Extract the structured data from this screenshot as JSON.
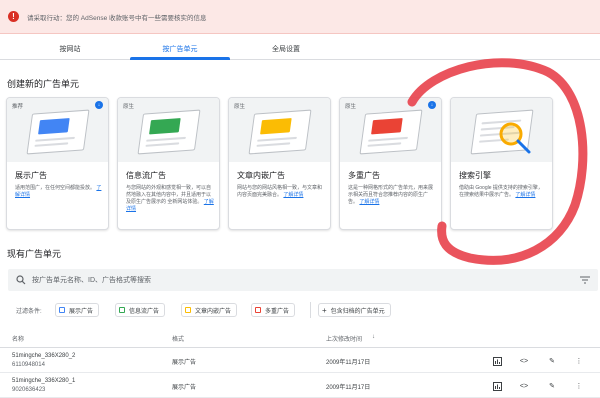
{
  "alert": {
    "text": "请采取行动：您的 AdSense 收款账号中有一些需要核实的信息"
  },
  "tabs": [
    {
      "label": "按网站"
    },
    {
      "label": "按广告单元"
    },
    {
      "label": "全局设置"
    }
  ],
  "create_section": {
    "title": "创建新的广告单元"
  },
  "cards": [
    {
      "tag": "推荐",
      "title": "展示广告",
      "desc": "适用范围广，在任何空间都能投放。",
      "link": "了解详情",
      "accent": "#4285f4"
    },
    {
      "tag": "原生",
      "title": "信息流广告",
      "desc": "与您网站的外观和感觉相一致，可以自然地融入在其他内容中，并且适用于以及原生广告展示的 全新网站体验。",
      "link": "了解详情",
      "accent": "#34a853"
    },
    {
      "tag": "原生",
      "title": "文章内嵌广告",
      "desc": "网站与您的网站风格相一致，与文章和内容页面完美融合。",
      "link": "了解详情",
      "accent": "#fbbc04"
    },
    {
      "tag": "原生",
      "title": "多重广告",
      "desc": "这是一种网格形式的广告单元，用来展示相关而且符合您推荐内容的原生广告。",
      "link": "了解详情",
      "accent": "#ea4335"
    },
    {
      "tag": "",
      "title": "搜索引擎",
      "desc": "借助由 Google 提供支持的搜索引擎，在搜索结果中展示广告。",
      "link": "了解详情",
      "accent": "#fbbc04"
    }
  ],
  "existing_section": {
    "title": "现有广告单元"
  },
  "search": {
    "placeholder": "按广告单元名称、ID、广告格式等搜索"
  },
  "filters": {
    "label": "过滤条件:",
    "chips": [
      {
        "label": "展示广告",
        "color": "#4285f4"
      },
      {
        "label": "信息流广告",
        "color": "#34a853"
      },
      {
        "label": "文章内嵌广告",
        "color": "#fbbc04"
      },
      {
        "label": "多重广告",
        "color": "#ea4335"
      }
    ],
    "archived": "包含归档的广告单元"
  },
  "table": {
    "headers": {
      "name": "名称",
      "format": "格式",
      "updated": "上次修改时间"
    },
    "rows": [
      {
        "name": "51mingche_336X280_2",
        "id": "6110948014",
        "format": "展示广告",
        "updated": "2009年11月17日"
      },
      {
        "name": "51mingche_336X280_1",
        "id": "9020636423",
        "format": "展示广告",
        "updated": "2009年11月17日"
      }
    ]
  },
  "icons": [
    "alert-icon",
    "search-icon",
    "filter-icon",
    "plus-icon",
    "sort-arrow-icon",
    "chart-icon",
    "code-icon",
    "edit-icon",
    "more-icon",
    "info-icon"
  ],
  "annotation": {
    "color": "#e8454f"
  }
}
